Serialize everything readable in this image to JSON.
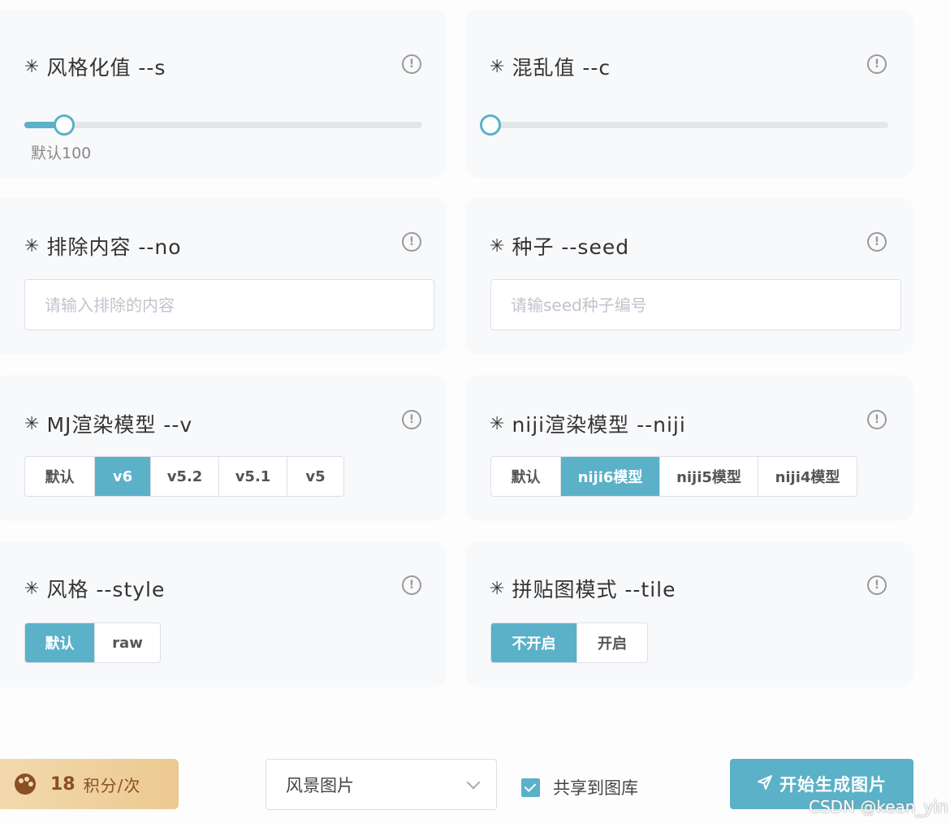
{
  "stylize": {
    "title": "风格化值 --s",
    "note": "默认100",
    "value_fraction": 0.1
  },
  "chaos": {
    "title": "混乱值 --c",
    "value_fraction": 0.0
  },
  "no": {
    "title": "排除内容 --no",
    "placeholder": "请输入排除的内容"
  },
  "seed": {
    "title": "种子 --seed",
    "placeholder": "请输seed种子编号"
  },
  "mj_model": {
    "title": "MJ渲染模型 --v",
    "options": [
      "默认",
      "v6",
      "v5.2",
      "v5.1",
      "v5"
    ],
    "selected": "v6"
  },
  "niji_model": {
    "title": "niji渲染模型 --niji",
    "options": [
      "默认",
      "niji6模型",
      "niji5模型",
      "niji4模型"
    ],
    "selected": "niji6模型"
  },
  "style": {
    "title": "风格 --style",
    "options": [
      "默认",
      "raw"
    ],
    "selected": "默认"
  },
  "tile": {
    "title": "拼贴图模式 --tile",
    "options": [
      "不开启",
      "开启"
    ],
    "selected": "不开启"
  },
  "info_glyph": "!",
  "star_glyph": "✳",
  "footer": {
    "cost_number": "18",
    "cost_unit": "积分/次",
    "category_select": "风景图片",
    "share_label": "共享到图库",
    "share_checked": true,
    "generate_label": "开始生成图片"
  },
  "watermark": "CSDN @kean_yin",
  "accent_color": "#5ab1c8"
}
